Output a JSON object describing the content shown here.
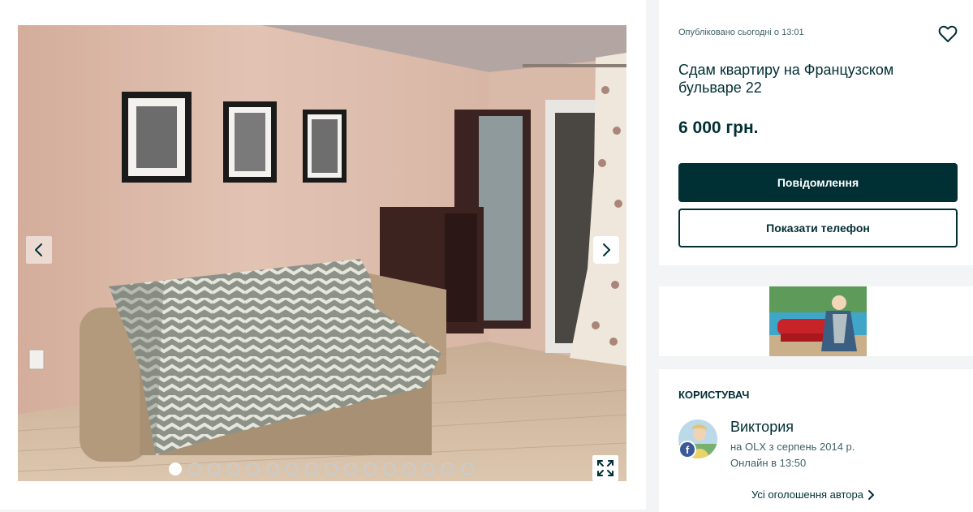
{
  "gallery": {
    "photo_count": 16,
    "active_photo": 1,
    "prev_icon": "chevron-left-icon",
    "next_icon": "chevron-right-icon",
    "expand_icon": "expand-icon"
  },
  "ad": {
    "published": "Опубліковано сьогодні о 13:01",
    "favorite_icon": "heart-outline-icon",
    "title": "Сдам квартиру на Французском бульваре 22",
    "price": "6 000 грн.",
    "message_button": "Повідомлення",
    "phone_button": "Показати телефон"
  },
  "user": {
    "heading": "КОРИСТУВАЧ",
    "name": "Виктория",
    "since": "на OLX з серпень 2014 р.",
    "online": "Онлайн в 13:50",
    "badge": "f",
    "all_ads_link": "Усі оголошення автора"
  },
  "colors": {
    "primary": "#002f34",
    "background": "#f2f4f5",
    "secondary_text": "#406367"
  }
}
